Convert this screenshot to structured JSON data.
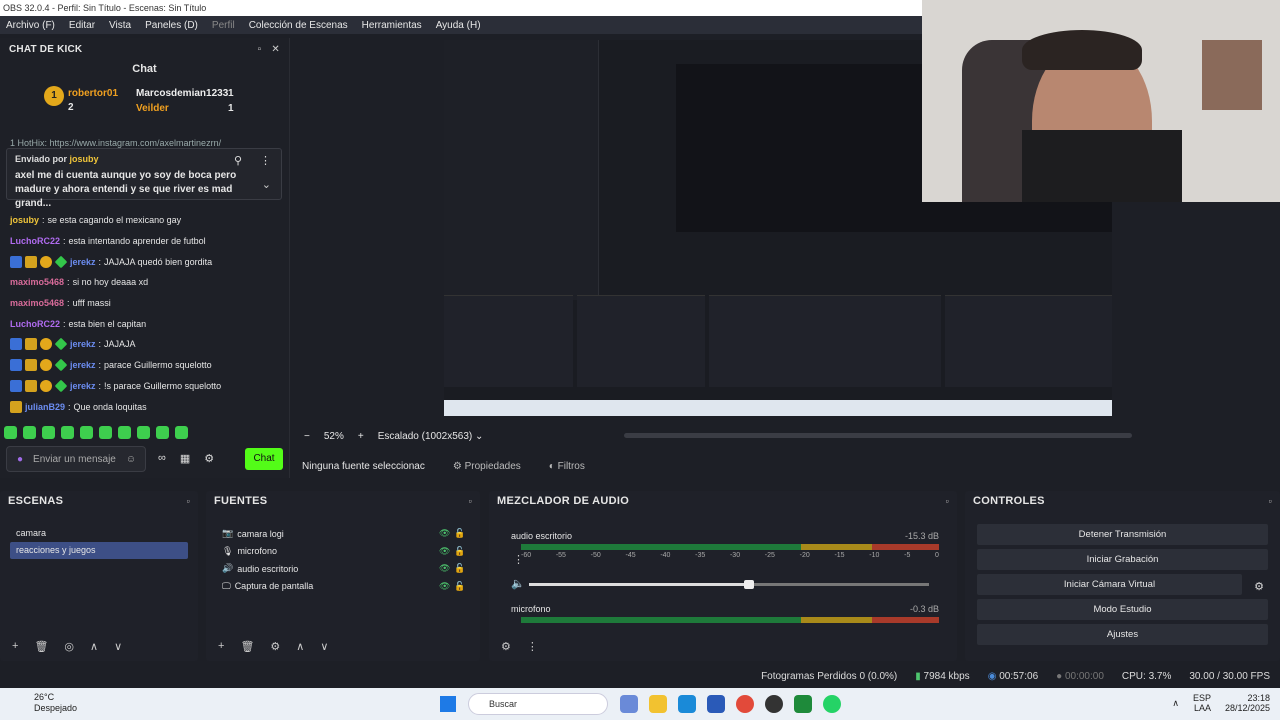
{
  "window_title": "OBS 32.0.4 - Perfil: Sin Título - Escenas: Sin Título",
  "menu": [
    "Archivo (F)",
    "Editar",
    "Vista",
    "Paneles (D)",
    "Perfil",
    "Colección de Escenas",
    "Herramientas",
    "Ayuda (H)"
  ],
  "chat_dock": {
    "title": "CHAT DE KICK",
    "chat_title": "Chat",
    "leaders": [
      {
        "name": "robertor01",
        "count": "1",
        "sub": "2"
      },
      {
        "name": "Marcosdemian1233",
        "count": "1"
      },
      {
        "name": "Veilder",
        "count": "1"
      }
    ],
    "cut_line": "1 HotHix: https://www.instagram.com/axelmartinezrn/",
    "pinned_label": "Enviado por",
    "pinned_user": "josuby",
    "pinned_message": "axel me di cuenta aunque yo soy de boca pero madure y ahora entendi y se que river es mad grand...",
    "messages": [
      {
        "user": "josuby",
        "color": "#f0c53a",
        "text": "se esta cagando el mexicano gay",
        "badges": 0
      },
      {
        "user": "LuchoRC22",
        "color": "#b06bf0",
        "text": "esta intentando aprender de futbol",
        "badges": 0
      },
      {
        "user": "jerekz",
        "color": "#6b8cf0",
        "text": "JAJAJA quedó bien gordita",
        "badges": 4
      },
      {
        "user": "maximo5468",
        "color": "#d86b9a",
        "text": "si no hoy deaaa xd",
        "badges": 0
      },
      {
        "user": "maximo5468",
        "color": "#d86b9a",
        "text": "ufff massi",
        "badges": 0
      },
      {
        "user": "LuchoRC22",
        "color": "#b06bf0",
        "text": "esta bien el capitan",
        "badges": 0
      },
      {
        "user": "jerekz",
        "color": "#6b8cf0",
        "text": "JAJAJA",
        "badges": 4
      },
      {
        "user": "jerekz",
        "color": "#6b8cf0",
        "text": "parace Guillermo squelotto",
        "badges": 4
      },
      {
        "user": "jerekz",
        "color": "#6b8cf0",
        "text": "!s parace Guillermo squelotto",
        "badges": 4
      },
      {
        "user": "julianB29",
        "color": "#6b8cf0",
        "text": "Que onda loquitas",
        "badges": 1
      }
    ],
    "input_placeholder": "Enviar un mensaje",
    "chat_button": "Chat"
  },
  "preview_controls": {
    "zoom": "52%",
    "scale_mode": "Escalado (1002x563)"
  },
  "context_bar": {
    "no_source": "Ninguna fuente seleccionac",
    "properties": "Propiedades",
    "filters": "Filtros"
  },
  "scenes": {
    "title": "ESCENAS",
    "items": [
      "camara",
      "reacciones y juegos"
    ],
    "selected": 1
  },
  "sources": {
    "title": "FUENTES",
    "items": [
      {
        "icon": "camera-icon",
        "label": "camara logi"
      },
      {
        "icon": "microphone-icon",
        "label": "microfono"
      },
      {
        "icon": "speaker-icon",
        "label": "audio escritorio"
      },
      {
        "icon": "monitor-icon",
        "label": "Captura de pantalla"
      }
    ]
  },
  "mixer": {
    "title": "MEZCLADOR DE AUDIO",
    "tracks": [
      {
        "name": "audio escritorio",
        "db": "-15.3 dB"
      },
      {
        "name": "microfono",
        "db": "-0.3 dB"
      }
    ],
    "scale": [
      "-60",
      "-55",
      "-50",
      "-45",
      "-40",
      "-35",
      "-30",
      "-25",
      "-20",
      "-15",
      "-10",
      "-5",
      "0"
    ],
    "desktop_volume": 0.55
  },
  "controls": {
    "title": "CONTROLES",
    "buttons": [
      "Detener Transmisión",
      "Iniciar Grabación",
      "Iniciar Cámara Virtual",
      "Modo Estudio",
      "Ajustes"
    ]
  },
  "status": {
    "dropped": "Fotogramas Perdidos 0 (0.0%)",
    "bitrate": "7984 kbps",
    "stream_time": "00:57:06",
    "rec_time": "00:00:00",
    "cpu": "CPU: 3.7%",
    "fps": "30.00 / 30.00 FPS"
  },
  "taskbar": {
    "temp": "26°C",
    "weather": "Despejado",
    "search": "Buscar",
    "lang": "ESP",
    "lang2": "LAA",
    "time": "23:18",
    "date": "28/12/2025"
  },
  "colors": {
    "accent": "#53fc18",
    "selection": "#3d4f86"
  }
}
